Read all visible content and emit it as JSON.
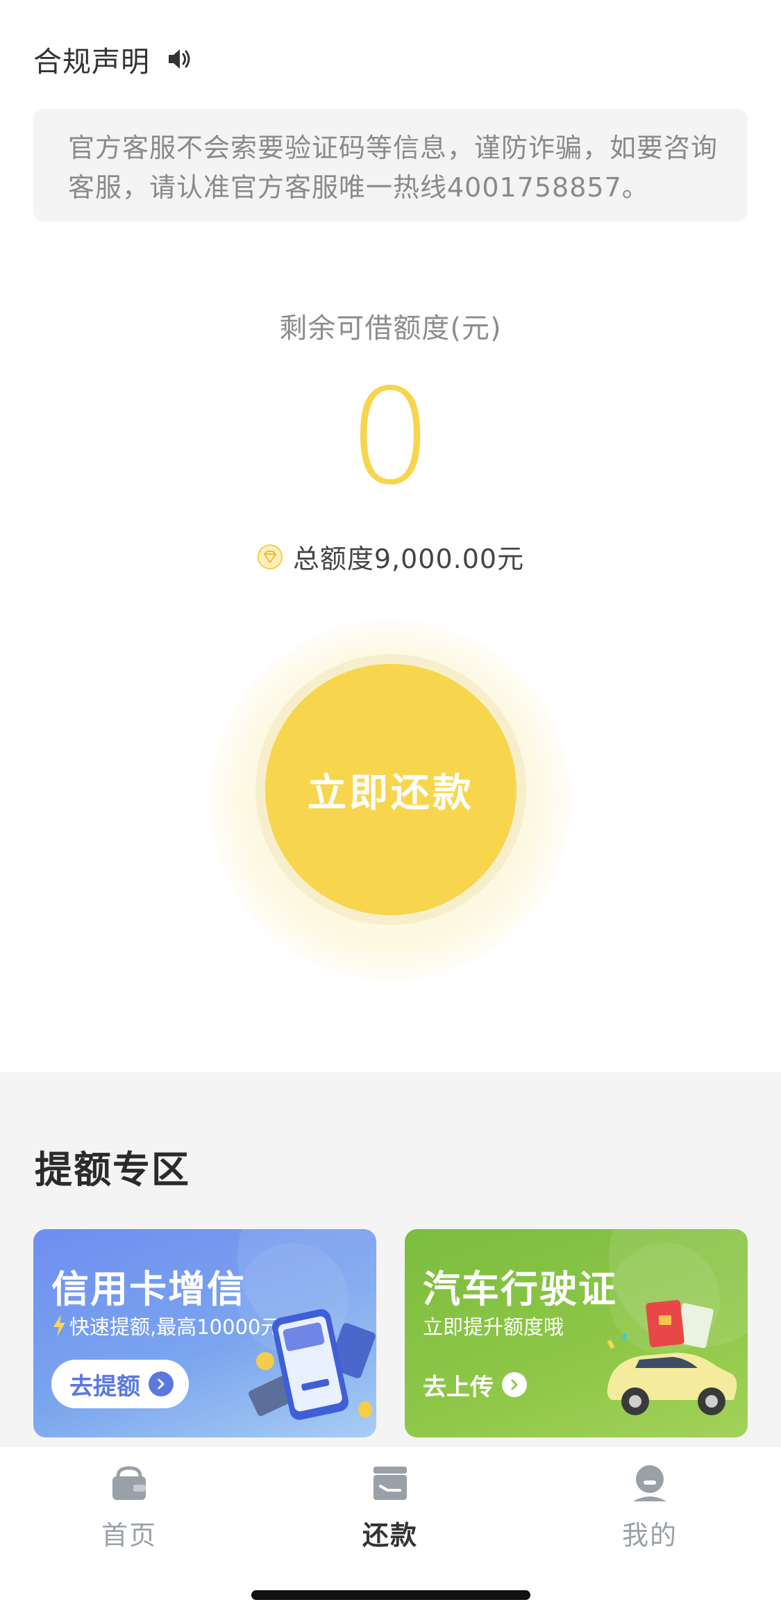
{
  "compliance": {
    "title": "合规声明",
    "icon": "speaker-icon",
    "notice": "官方客服不会索要验证码等信息，谨防诈骗，如要咨询客服，请认准官方客服唯一热线4001758857。"
  },
  "credit": {
    "label": "剩余可借额度(元)",
    "value": "0",
    "total_icon": "diamond-badge-icon",
    "total_text": "总额度9,000.00元"
  },
  "repay_button": {
    "label": "立即还款"
  },
  "promo": {
    "title": "提额专区",
    "cards": [
      {
        "title": "信用卡增信",
        "subtitle": "快速提额,最高10000元",
        "button": "去提额",
        "subtitle_icon": "lightning-icon",
        "illustration": "phone-card-illustration"
      },
      {
        "title": "汽车行驶证",
        "subtitle": "立即提升额度哦",
        "button": "去上传",
        "illustration": "car-illustration"
      }
    ]
  },
  "tab_bar": {
    "items": [
      {
        "label": "首页",
        "icon": "wallet-icon",
        "active": false
      },
      {
        "label": "还款",
        "icon": "card-repay-icon",
        "active": true
      },
      {
        "label": "我的",
        "icon": "user-icon",
        "active": false
      }
    ]
  },
  "colors": {
    "accent_yellow": "#f7d64e",
    "credit_card_blue": "#6f8ef0",
    "car_card_green": "#8fc748",
    "tab_inactive": "#9aa0a8"
  }
}
